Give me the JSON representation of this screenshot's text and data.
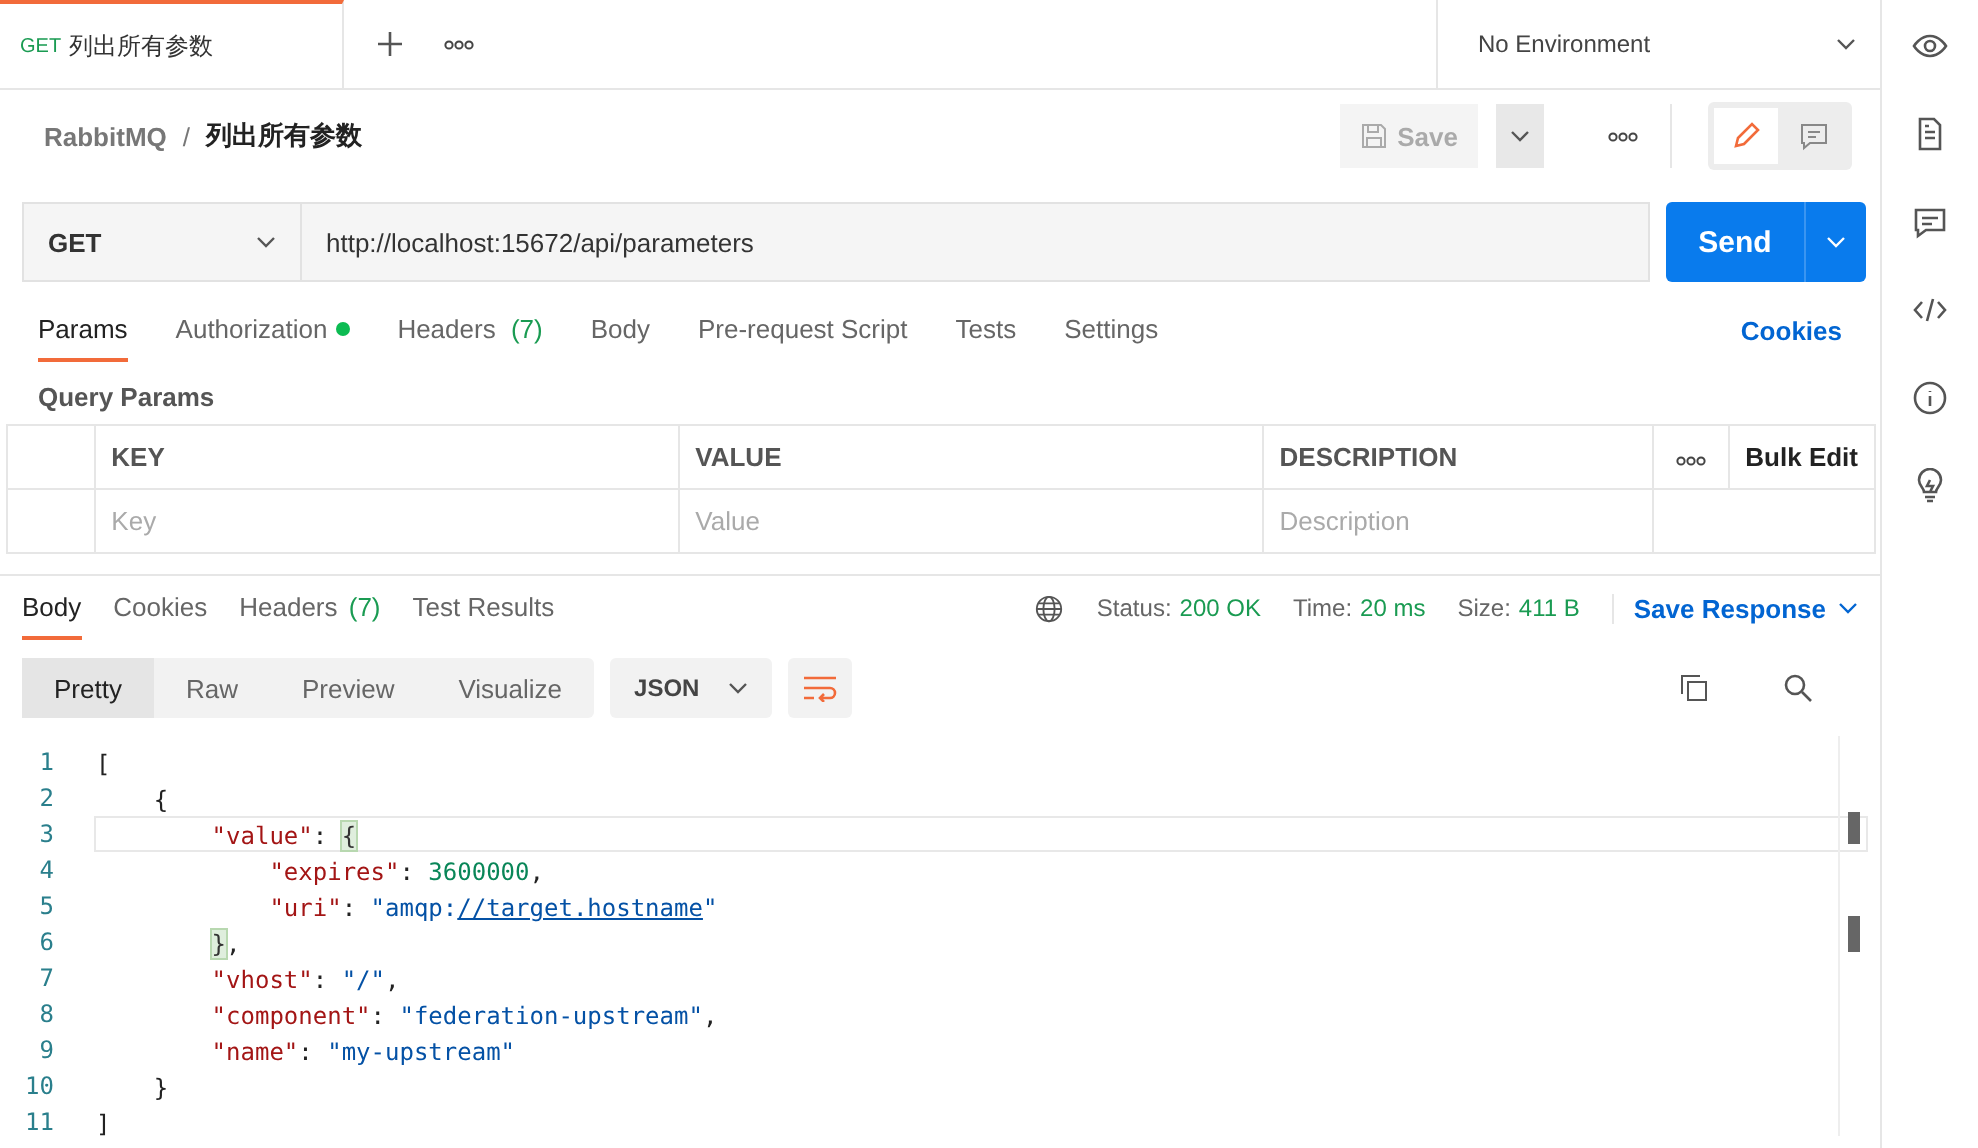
{
  "request_tabs": [
    {
      "method": "GET",
      "title": "列出所有参数",
      "selected": true
    }
  ],
  "environment": {
    "value": "No Environment"
  },
  "breadcrumb": {
    "collection": "RabbitMQ",
    "separator": "/",
    "request": "列出所有参数"
  },
  "save_button": {
    "label": "Save",
    "disabled": true
  },
  "request": {
    "method": "GET",
    "url": "http://localhost:15672/api/parameters",
    "send_label": "Send"
  },
  "request_tabs_bar": [
    {
      "label": "Params",
      "selected": true,
      "indicator": false
    },
    {
      "label": "Authorization",
      "selected": false,
      "indicator": true
    },
    {
      "label": "Headers",
      "count": "(7)",
      "selected": false,
      "indicator": false
    },
    {
      "label": "Body",
      "selected": false,
      "indicator": false
    },
    {
      "label": "Pre-request Script",
      "selected": false,
      "indicator": false
    },
    {
      "label": "Tests",
      "selected": false,
      "indicator": false
    },
    {
      "label": "Settings",
      "selected": false,
      "indicator": false
    }
  ],
  "cookies_link": "Cookies",
  "query_params": {
    "title": "Query Params",
    "columns": [
      "KEY",
      "VALUE",
      "DESCRIPTION"
    ],
    "bulk_edit": "Bulk Edit",
    "placeholders": [
      "Key",
      "Value",
      "Description"
    ]
  },
  "response_tabs": [
    {
      "label": "Body",
      "selected": true
    },
    {
      "label": "Cookies",
      "selected": false
    },
    {
      "label": "Headers",
      "count": "(7)",
      "selected": false
    },
    {
      "label": "Test Results",
      "selected": false
    }
  ],
  "status": [
    {
      "label": "Status:",
      "value": "200 OK"
    },
    {
      "label": "Time:",
      "value": "20 ms"
    },
    {
      "label": "Size:",
      "value": "411 B"
    }
  ],
  "save_response": "Save Response",
  "view_modes": [
    {
      "label": "Pretty",
      "selected": true
    },
    {
      "label": "Raw",
      "selected": false
    },
    {
      "label": "Preview",
      "selected": false
    },
    {
      "label": "Visualize",
      "selected": false
    }
  ],
  "format": "JSON",
  "wrap_enabled": true,
  "code_lines": [
    {
      "number": "1",
      "highlighted": false,
      "tokens": [
        {
          "kind": "punct",
          "text": "["
        }
      ]
    },
    {
      "number": "2",
      "highlighted": false,
      "tokens": [
        {
          "kind": "punct",
          "text": "    {"
        }
      ]
    },
    {
      "number": "3",
      "highlighted": true,
      "tokens": [
        {
          "kind": "key",
          "text": "        \"value\""
        },
        {
          "kind": "punct",
          "text": ": "
        },
        {
          "kind": "match",
          "text": "{"
        }
      ]
    },
    {
      "number": "4",
      "highlighted": false,
      "tokens": [
        {
          "kind": "key",
          "text": "            \"expires\""
        },
        {
          "kind": "punct",
          "text": ": "
        },
        {
          "kind": "number",
          "text": "3600000"
        },
        {
          "kind": "punct",
          "text": ","
        }
      ]
    },
    {
      "number": "5",
      "highlighted": false,
      "tokens": [
        {
          "kind": "key",
          "text": "            \"uri\""
        },
        {
          "kind": "punct",
          "text": ": "
        },
        {
          "kind": "string",
          "text": "\"amqp:"
        },
        {
          "kind": "link",
          "text": "//target.hostname"
        },
        {
          "kind": "string",
          "text": "\""
        }
      ]
    },
    {
      "number": "6",
      "highlighted": false,
      "tokens": [
        {
          "kind": "match",
          "text": "        }"
        },
        {
          "kind": "punct",
          "text": ","
        }
      ]
    },
    {
      "number": "7",
      "highlighted": false,
      "tokens": [
        {
          "kind": "key",
          "text": "        \"vhost\""
        },
        {
          "kind": "punct",
          "text": ": "
        },
        {
          "kind": "string",
          "text": "\"/\""
        },
        {
          "kind": "punct",
          "text": ","
        }
      ]
    },
    {
      "number": "8",
      "highlighted": false,
      "tokens": [
        {
          "kind": "key",
          "text": "        \"component\""
        },
        {
          "kind": "punct",
          "text": ": "
        },
        {
          "kind": "string",
          "text": "\"federation-upstream\""
        },
        {
          "kind": "punct",
          "text": ","
        }
      ]
    },
    {
      "number": "9",
      "highlighted": false,
      "tokens": [
        {
          "kind": "key",
          "text": "        \"name\""
        },
        {
          "kind": "punct",
          "text": ": "
        },
        {
          "kind": "string",
          "text": "\"my-upstream\""
        }
      ]
    },
    {
      "number": "10",
      "highlighted": false,
      "tokens": [
        {
          "kind": "punct",
          "text": "    }"
        }
      ]
    },
    {
      "number": "11",
      "highlighted": false,
      "tokens": [
        {
          "kind": "punct",
          "text": "]"
        }
      ]
    }
  ]
}
